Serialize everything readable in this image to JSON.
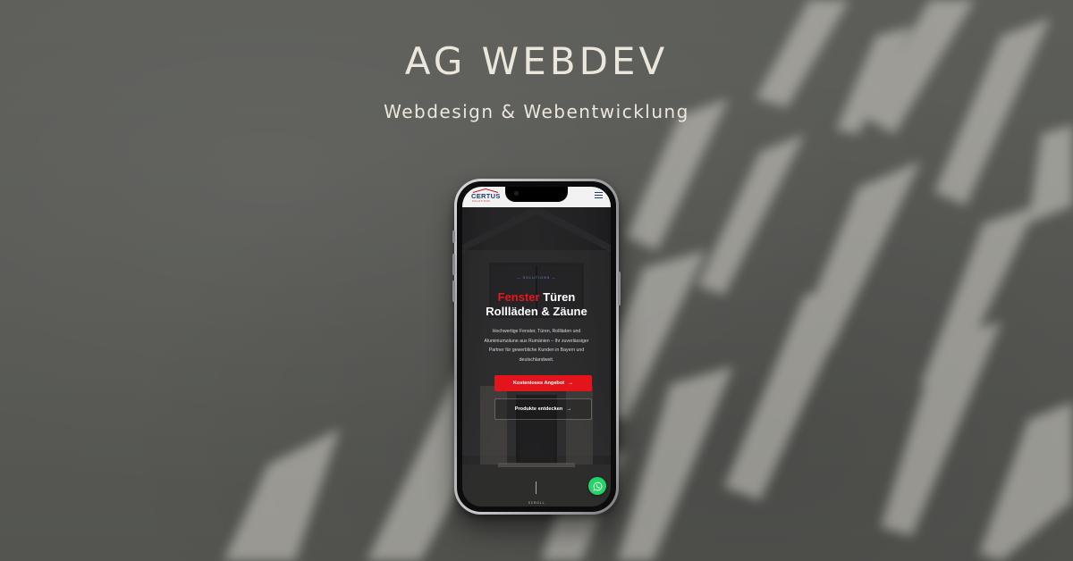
{
  "banner": {
    "title": "AG WEBDEV",
    "subtitle": "Webdesign & Webentwicklung"
  },
  "site": {
    "logo_text": "CERTUS",
    "logo_subtext": "SOLUTIONS",
    "hero": {
      "eyebrow": "— SOLUTIONS —",
      "headline_accent": "Fenster",
      "headline_rest": " Türen",
      "headline_line2": "Rollläden & Zäune",
      "description": "Hochwertige Fenster, Türen, Rollläden und Aluminiumzäune aus Rumänien – Ihr zuverlässiger Partner für gewerbliche Kunden in Bayern und deutschlandweit.",
      "cta_primary": "Kostenloses Angebot",
      "cta_secondary": "Produkte entdecken",
      "scroll_label": "SCROLL"
    }
  },
  "colors": {
    "accent_red": "#e3141b",
    "brand_blue": "#1a3a7c",
    "whatsapp_green": "#25d366",
    "background": "#575854"
  },
  "icons": [
    "menu-icon",
    "arrow-right-icon",
    "whatsapp-icon"
  ]
}
